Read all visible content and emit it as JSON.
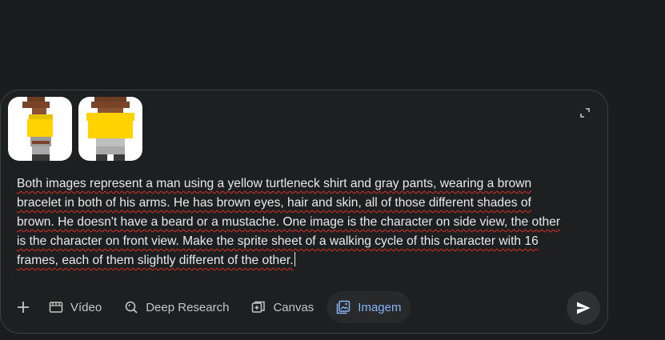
{
  "attachments": [
    {
      "name": "side-view-character"
    },
    {
      "name": "front-view-character"
    }
  ],
  "prompt": {
    "text": "Both images represent a man using a yellow turtleneck shirt and gray pants, wearing a brown bracelet in both of his arms. He has brown eyes, hair and skin, all of those different shades of brown. He doesn't have a beard or a mustache. One image is the character on side view, the other is the character on front view. Make the sprite sheet of a walking cycle of this character with 16 frames, each of them slightly different of the other."
  },
  "toolbar": {
    "tools": [
      {
        "label": "Vídeo",
        "icon": "video-icon"
      },
      {
        "label": "Deep Research",
        "icon": "deep-research-icon"
      },
      {
        "label": "Canvas",
        "icon": "canvas-icon"
      },
      {
        "label": "Imagem",
        "icon": "image-icon",
        "active": true
      }
    ]
  },
  "colors": {
    "background": "#1b1c1d",
    "composer": "#1e1f20",
    "active_tool_text": "#8ab4f8",
    "spellcheck": "#d93025"
  }
}
